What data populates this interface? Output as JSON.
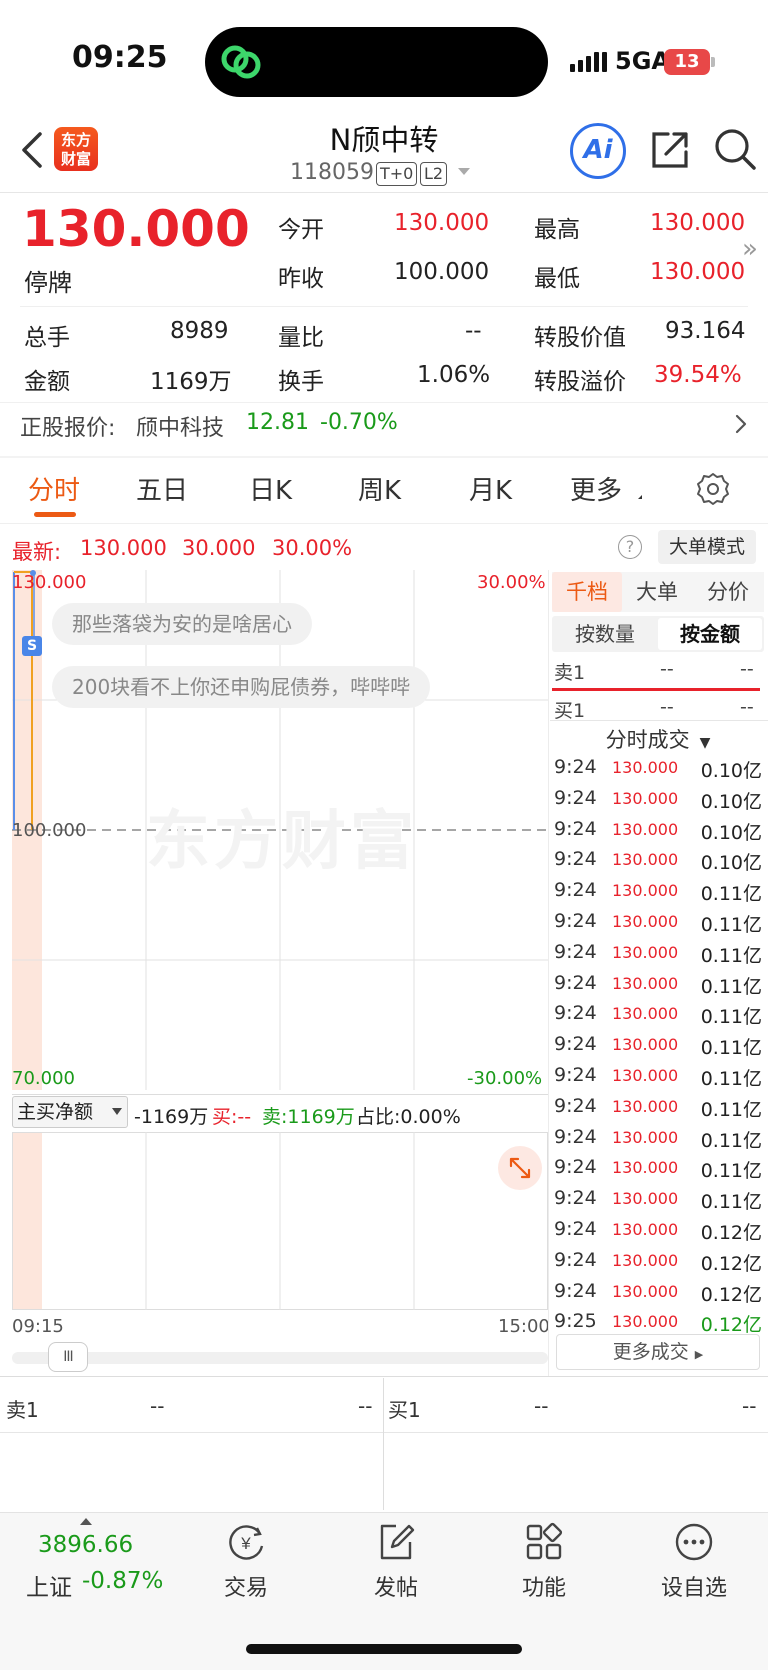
{
  "status": {
    "time": "09:25",
    "network": "5GA",
    "battery": "13"
  },
  "header": {
    "brand_line1": "东方",
    "brand_line2": "财富",
    "title": "N颀中转",
    "code": "118059",
    "tag1": "T+0",
    "tag2": "L2",
    "ai": "Ai"
  },
  "quote": {
    "price": "130.000",
    "status": "停牌",
    "open_label": "今开",
    "open": "130.000",
    "high_label": "最高",
    "high": "130.000",
    "prev_label": "昨收",
    "prev": "100.000",
    "low_label": "最低",
    "low": "130.000",
    "vol_label": "总手",
    "vol": "8989",
    "ratio_label": "量比",
    "ratio": "--",
    "conv_label": "转股价值",
    "conv": "93.164",
    "amt_label": "金额",
    "amt": "1169万",
    "turn_label": "换手",
    "turn": "1.06%",
    "prem_label": "转股溢价",
    "prem": "39.54%"
  },
  "underlying": {
    "label": "正股报价:",
    "name": "颀中科技",
    "price": "12.81",
    "change": "-0.70%"
  },
  "tabs": [
    "分时",
    "五日",
    "日K",
    "周K",
    "月K",
    "更多"
  ],
  "chart_header": {
    "latest_label": "最新:",
    "latest": "130.000",
    "chg": "30.000",
    "pct": "30.00%",
    "help": "?",
    "mode": "大单模式"
  },
  "chart_labels": {
    "top_left": "130.000",
    "top_right": "30.00%",
    "mid": "100.000",
    "bot_left": "70.000",
    "bot_right": "-30.00%",
    "s_marker": "S",
    "watermark": "东方财富"
  },
  "bubbles": [
    "那些落袋为安的是啥居心",
    "200块看不上你还申购屁债券，哔哔哔"
  ],
  "netflow": {
    "selector": "主买净额",
    "value": "-1169万",
    "buy_label": "买:--",
    "sell_label": "卖:1169万",
    "ratio_label": "占比:0.00%"
  },
  "time_axis": {
    "start": "09:15",
    "end": "15:00"
  },
  "slider_handle": "III",
  "right_panel": {
    "tabs": [
      "千档",
      "大单",
      "分价"
    ],
    "subtabs": [
      "按数量",
      "按金额"
    ],
    "sell1": {
      "label": "卖1",
      "a": "--",
      "b": "--"
    },
    "buy1": {
      "label": "买1",
      "a": "--",
      "b": "--"
    },
    "trades_header": "分时成交",
    "trades": [
      {
        "t": "9:24",
        "p": "130.000",
        "v": "0.10亿",
        "c": "red"
      },
      {
        "t": "9:24",
        "p": "130.000",
        "v": "0.10亿",
        "c": "red"
      },
      {
        "t": "9:24",
        "p": "130.000",
        "v": "0.10亿",
        "c": "red"
      },
      {
        "t": "9:24",
        "p": "130.000",
        "v": "0.10亿",
        "c": "red"
      },
      {
        "t": "9:24",
        "p": "130.000",
        "v": "0.11亿",
        "c": "red"
      },
      {
        "t": "9:24",
        "p": "130.000",
        "v": "0.11亿",
        "c": "red"
      },
      {
        "t": "9:24",
        "p": "130.000",
        "v": "0.11亿",
        "c": "red"
      },
      {
        "t": "9:24",
        "p": "130.000",
        "v": "0.11亿",
        "c": "red"
      },
      {
        "t": "9:24",
        "p": "130.000",
        "v": "0.11亿",
        "c": "red"
      },
      {
        "t": "9:24",
        "p": "130.000",
        "v": "0.11亿",
        "c": "red"
      },
      {
        "t": "9:24",
        "p": "130.000",
        "v": "0.11亿",
        "c": "red"
      },
      {
        "t": "9:24",
        "p": "130.000",
        "v": "0.11亿",
        "c": "red"
      },
      {
        "t": "9:24",
        "p": "130.000",
        "v": "0.11亿",
        "c": "red"
      },
      {
        "t": "9:24",
        "p": "130.000",
        "v": "0.11亿",
        "c": "red"
      },
      {
        "t": "9:24",
        "p": "130.000",
        "v": "0.11亿",
        "c": "red"
      },
      {
        "t": "9:24",
        "p": "130.000",
        "v": "0.12亿",
        "c": "red"
      },
      {
        "t": "9:24",
        "p": "130.000",
        "v": "0.12亿",
        "c": "red"
      },
      {
        "t": "9:24",
        "p": "130.000",
        "v": "0.12亿",
        "c": "red"
      },
      {
        "t": "9:25",
        "p": "130.000",
        "v": "0.12亿",
        "c": "green"
      }
    ],
    "more": "更多成交"
  },
  "orderbook": {
    "sell_label": "卖1",
    "sell_a": "--",
    "sell_b": "--",
    "buy_label": "买1",
    "buy_a": "--",
    "buy_b": "--"
  },
  "bottom_nav": {
    "index_value": "3896.66",
    "index_name": "上证",
    "index_change": "-0.87%",
    "items": [
      "交易",
      "发帖",
      "功能",
      "设自选"
    ]
  },
  "colors": {
    "up": "#e8222b",
    "down": "#1a9a1a",
    "accent": "#ec5a14",
    "ai": "#2f6fe8"
  }
}
